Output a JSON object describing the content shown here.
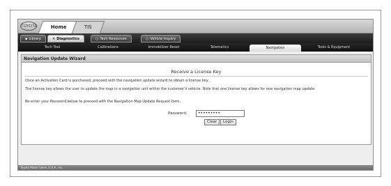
{
  "header": {
    "logo_text": "TOYOTA",
    "tabs": [
      {
        "label": "Home"
      },
      {
        "label": "TIS"
      }
    ]
  },
  "subtabs": [
    {
      "label": "Library",
      "icon": "book-icon"
    },
    {
      "label": "Diagnostics",
      "icon": "stethoscope-icon"
    },
    {
      "label": "Tech Resources",
      "icon": "wrench-icon"
    },
    {
      "label": "Vehicle Inquiry",
      "icon": "car-icon"
    }
  ],
  "sections": [
    {
      "label": "Tech Tool"
    },
    {
      "label": "Calibrations"
    },
    {
      "label": "Immobilizer Reset"
    },
    {
      "label": "Telematics"
    },
    {
      "label": "Navigation"
    },
    {
      "label": "Tools & Equipment"
    }
  ],
  "wizard": {
    "title": "Navigation Update Wizard",
    "heading": "Receive a License Key",
    "paragraphs": [
      "Once an Activation Card is purchased, proceed with the navigation update wizard to obtain a license key.",
      "The license key allows the user to update the map in a navigation unit within the customer's vehicle. Note that one license key allows for one navigation map update.",
      "Re-enter your Password below to proceed with the Navigation Map Update Request form."
    ],
    "password_label": "Password:",
    "password_value": "•••••••••",
    "clear_label": "Clear",
    "login_label": "Login"
  },
  "status": {
    "text": "Toyota Motor Sales, U.S.A., Inc."
  }
}
